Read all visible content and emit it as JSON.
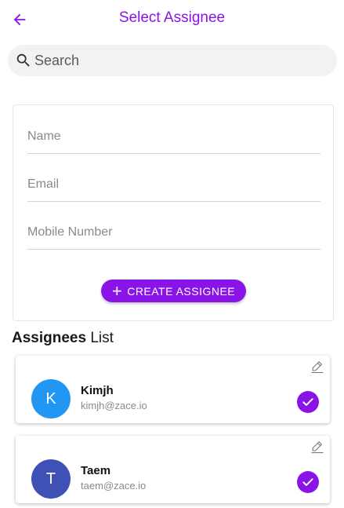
{
  "header": {
    "title": "Select Assignee",
    "back_icon": "arrow-left-icon"
  },
  "search": {
    "placeholder": "Search",
    "value": ""
  },
  "form": {
    "name_placeholder": "Name",
    "email_placeholder": "Email",
    "mobile_placeholder": "Mobile Number",
    "create_label": "CREATE ASSIGNEE",
    "create_icon": "plus-icon"
  },
  "list": {
    "title_bold": "Assignees",
    "title_rest": "List",
    "items": [
      {
        "initial": "K",
        "name": "Kimjh",
        "email": "kimjh@zace.io",
        "avatar_color": "#2196f3",
        "selected": true
      },
      {
        "initial": "T",
        "name": "Taem",
        "email": "taem@zace.io",
        "avatar_color": "#3f51b5",
        "selected": true
      }
    ]
  },
  "colors": {
    "accent": "#8a14e8",
    "search_bg": "#f2f2f2"
  }
}
